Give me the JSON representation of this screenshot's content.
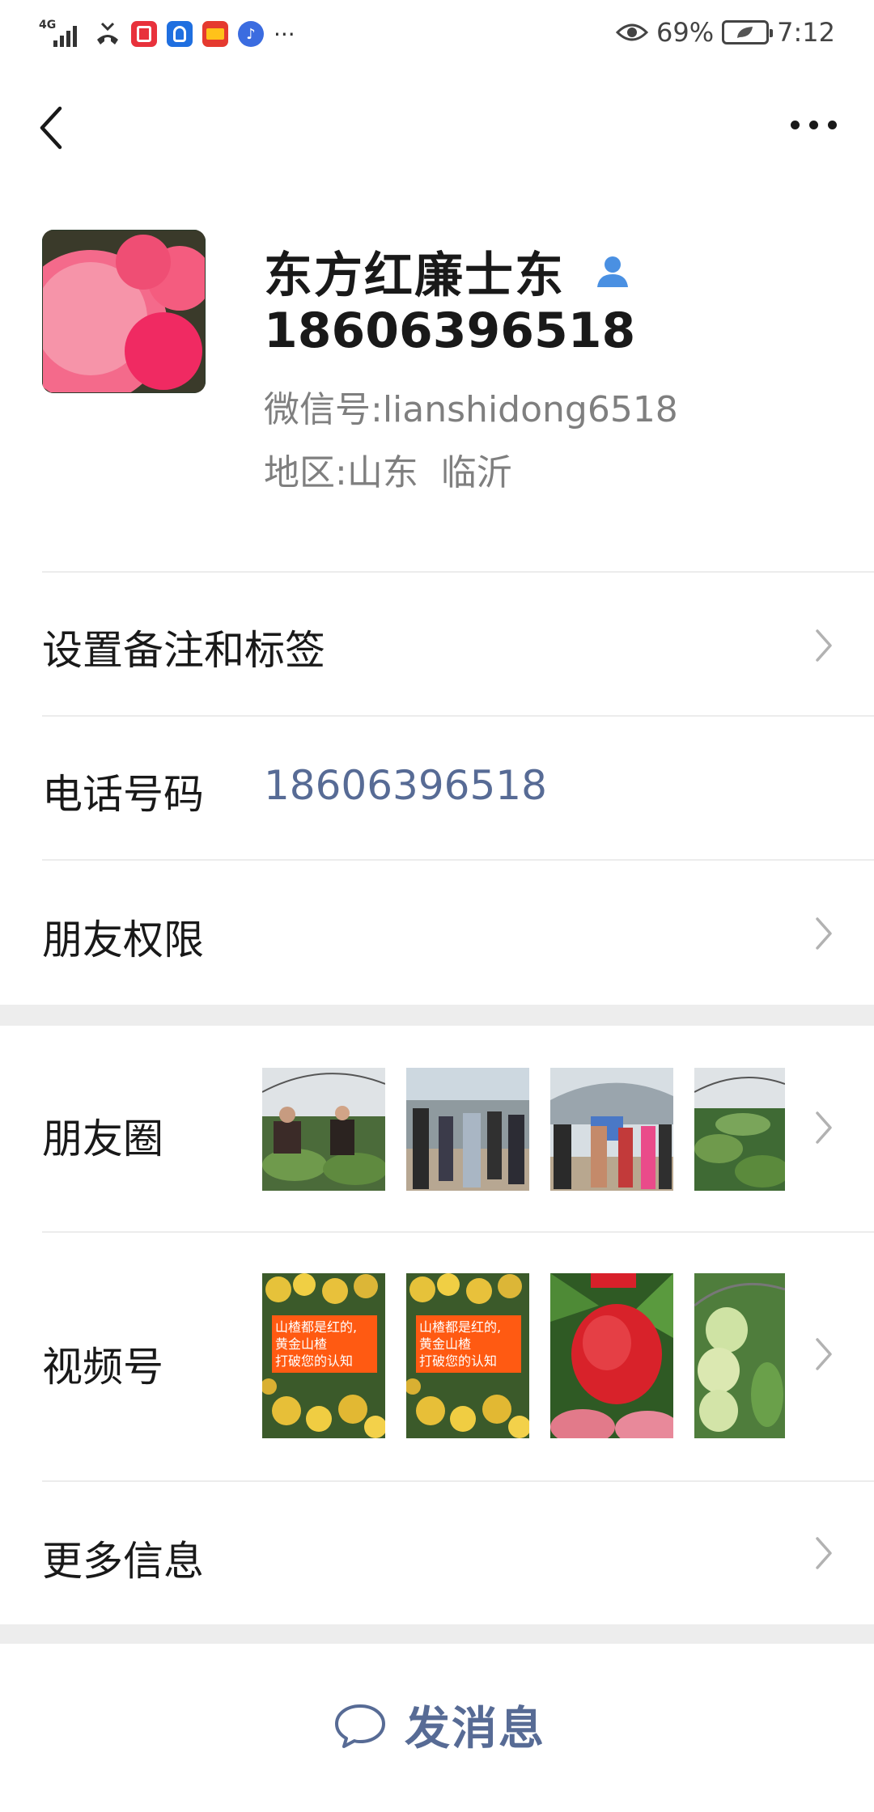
{
  "status_bar": {
    "network": "4G",
    "battery": "69%",
    "time": "7:12",
    "overflow": "···",
    "icons": [
      "signal-icon",
      "missed-call-icon",
      "reader-app-icon",
      "bulb-app-icon",
      "wallet-app-icon",
      "music-app-icon",
      "eye-icon",
      "battery-icon"
    ]
  },
  "header": {
    "back_icon": "chevron-left-icon",
    "more_icon": "more-dots-icon"
  },
  "profile": {
    "name": "东方红廉士东",
    "phone": "18606396518",
    "wechat_label": "微信号:",
    "wechat_id": "lianshidong6518",
    "region_label": "地区:",
    "region": "山东  临沂",
    "badge_icon": "contact-person-icon"
  },
  "rows": {
    "remark_label": "设置备注和标签",
    "phone_label": "电话号码",
    "phone_value": "18606396518",
    "permission_label": "朋友权限",
    "moments_label": "朋友圈",
    "channels_label": "视频号",
    "more_info_label": "更多信息"
  },
  "channels_thumbs": {
    "overlay_1": "山楂都是红的,\n黄金山楂\n打破您的认知",
    "overlay_2": "山楂都是红的,\n黄金山楂\n打破您的认知"
  },
  "footer": {
    "send_message_label": "发消息",
    "chat_icon": "chat-bubble-icon"
  },
  "colors": {
    "link_blue": "#576b95",
    "section_gap": "#ededed",
    "text_gray": "#7f7f7f"
  }
}
